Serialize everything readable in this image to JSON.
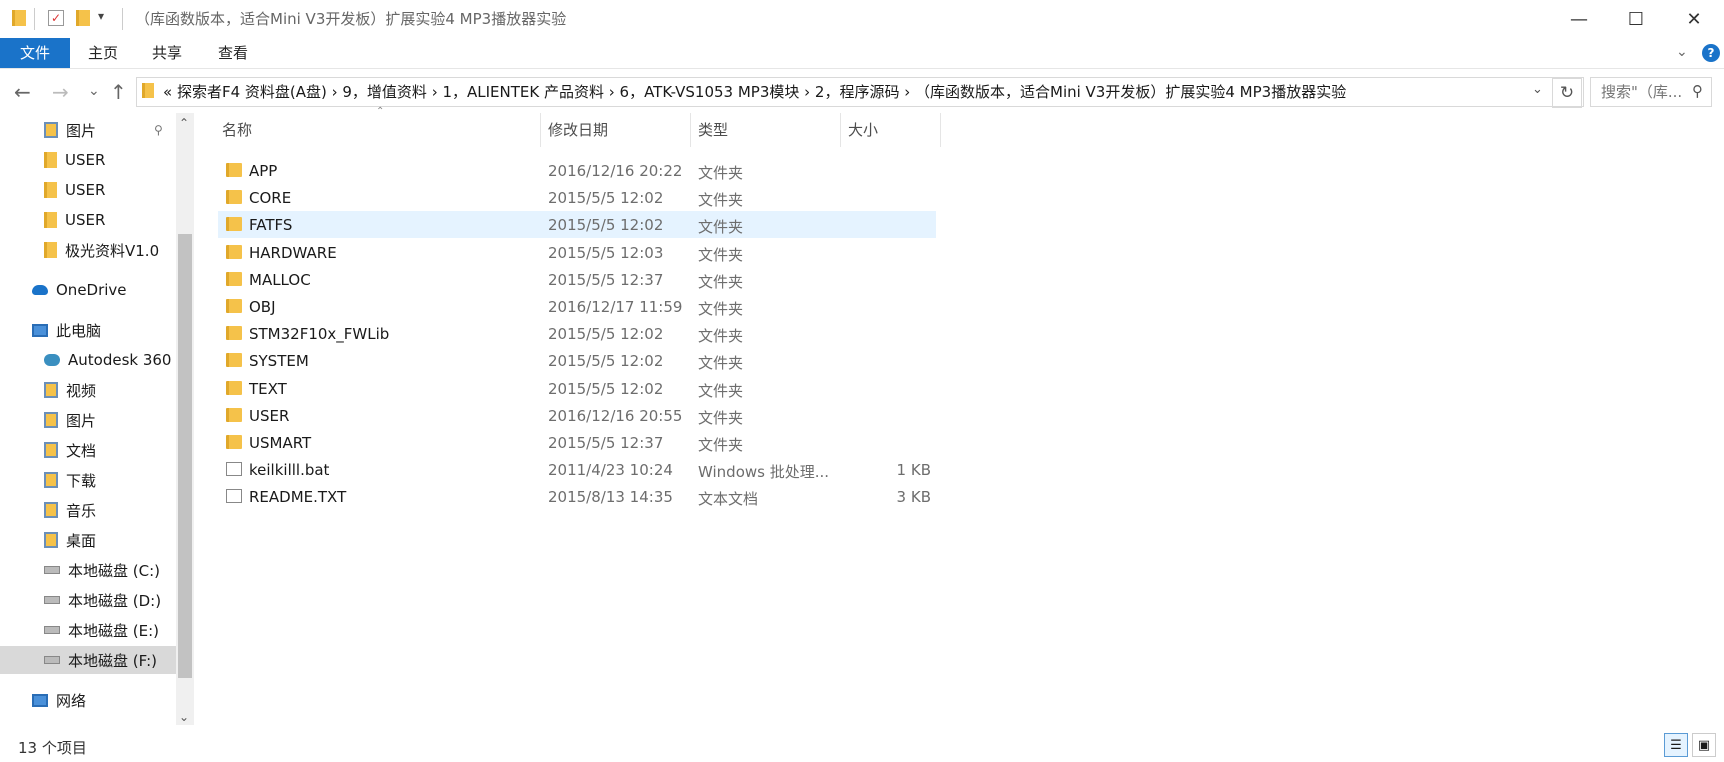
{
  "window": {
    "title": "（库函数版本，适合Mini V3开发板）扩展实验4 MP3播放器实验",
    "minimize": "—",
    "maximize": "☐",
    "close": "✕"
  },
  "ribbon": {
    "tabs": [
      "文件",
      "主页",
      "共享",
      "查看"
    ],
    "help": "?"
  },
  "address": {
    "path": "«  探索者F4 资料盘(A盘)  ›  9，增值资料  ›  1，ALIENTEK 产品资料  ›  6，ATK-VS1053 MP3模块  ›  2，程序源码  ›  （库函数版本，适合Mini V3开发板）扩展实验4 MP3播放器实验",
    "search_placeholder": "搜索\"（库...",
    "refresh": "↻",
    "back": "←",
    "forward": "→",
    "recent": "⌄",
    "up": "↑"
  },
  "nav": {
    "items": [
      {
        "label": "图片",
        "icon": "pictures-icon",
        "indent": 1,
        "pinned": true
      },
      {
        "label": "USER",
        "icon": "folder-icon",
        "indent": 1
      },
      {
        "label": "USER",
        "icon": "folder-icon",
        "indent": 1
      },
      {
        "label": "USER",
        "icon": "folder-icon",
        "indent": 1
      },
      {
        "label": "极光资料V1.0",
        "icon": "folder-icon",
        "indent": 1
      },
      {
        "label": "OneDrive",
        "icon": "onedrive-icon",
        "indent": 0
      },
      {
        "label": "此电脑",
        "icon": "computer-icon",
        "indent": 0
      },
      {
        "label": "Autodesk 360",
        "icon": "autodesk-icon",
        "indent": 1
      },
      {
        "label": "视频",
        "icon": "videos-icon",
        "indent": 1
      },
      {
        "label": "图片",
        "icon": "pictures-icon",
        "indent": 1
      },
      {
        "label": "文档",
        "icon": "documents-icon",
        "indent": 1
      },
      {
        "label": "下载",
        "icon": "downloads-icon",
        "indent": 1
      },
      {
        "label": "音乐",
        "icon": "music-icon",
        "indent": 1
      },
      {
        "label": "桌面",
        "icon": "desktop-icon",
        "indent": 1
      },
      {
        "label": "本地磁盘 (C:)",
        "icon": "drive-icon",
        "indent": 1
      },
      {
        "label": "本地磁盘 (D:)",
        "icon": "drive-icon",
        "indent": 1
      },
      {
        "label": "本地磁盘 (E:)",
        "icon": "drive-icon",
        "indent": 1
      },
      {
        "label": "本地磁盘 (F:)",
        "icon": "drive-icon",
        "indent": 1,
        "selected": true
      },
      {
        "label": "网络",
        "icon": "network-icon",
        "indent": 0
      }
    ]
  },
  "columns": {
    "name": "名称",
    "date": "修改日期",
    "type": "类型",
    "size": "大小"
  },
  "files": [
    {
      "name": "APP",
      "date": "2016/12/16 20:22",
      "type": "文件夹",
      "size": "",
      "kind": "folder"
    },
    {
      "name": "CORE",
      "date": "2015/5/5 12:02",
      "type": "文件夹",
      "size": "",
      "kind": "folder"
    },
    {
      "name": "FATFS",
      "date": "2015/5/5 12:02",
      "type": "文件夹",
      "size": "",
      "kind": "folder",
      "selected": true
    },
    {
      "name": "HARDWARE",
      "date": "2015/5/5 12:03",
      "type": "文件夹",
      "size": "",
      "kind": "folder"
    },
    {
      "name": "MALLOC",
      "date": "2015/5/5 12:37",
      "type": "文件夹",
      "size": "",
      "kind": "folder"
    },
    {
      "name": "OBJ",
      "date": "2016/12/17 11:59",
      "type": "文件夹",
      "size": "",
      "kind": "folder"
    },
    {
      "name": "STM32F10x_FWLib",
      "date": "2015/5/5 12:02",
      "type": "文件夹",
      "size": "",
      "kind": "folder"
    },
    {
      "name": "SYSTEM",
      "date": "2015/5/5 12:02",
      "type": "文件夹",
      "size": "",
      "kind": "folder"
    },
    {
      "name": "TEXT",
      "date": "2015/5/5 12:02",
      "type": "文件夹",
      "size": "",
      "kind": "folder"
    },
    {
      "name": "USER",
      "date": "2016/12/16 20:55",
      "type": "文件夹",
      "size": "",
      "kind": "folder"
    },
    {
      "name": "USMART",
      "date": "2015/5/5 12:37",
      "type": "文件夹",
      "size": "",
      "kind": "folder"
    },
    {
      "name": "keilkilll.bat",
      "date": "2011/4/23 10:24",
      "type": "Windows 批处理...",
      "size": "1 KB",
      "kind": "bat"
    },
    {
      "name": "README.TXT",
      "date": "2015/8/13 14:35",
      "type": "文本文档",
      "size": "3 KB",
      "kind": "txt"
    }
  ],
  "status": {
    "item_count": "13 个项目"
  },
  "colors": {
    "accent": "#1a73c9",
    "selection": "#e5f3ff",
    "folder": "#f5c24a"
  }
}
